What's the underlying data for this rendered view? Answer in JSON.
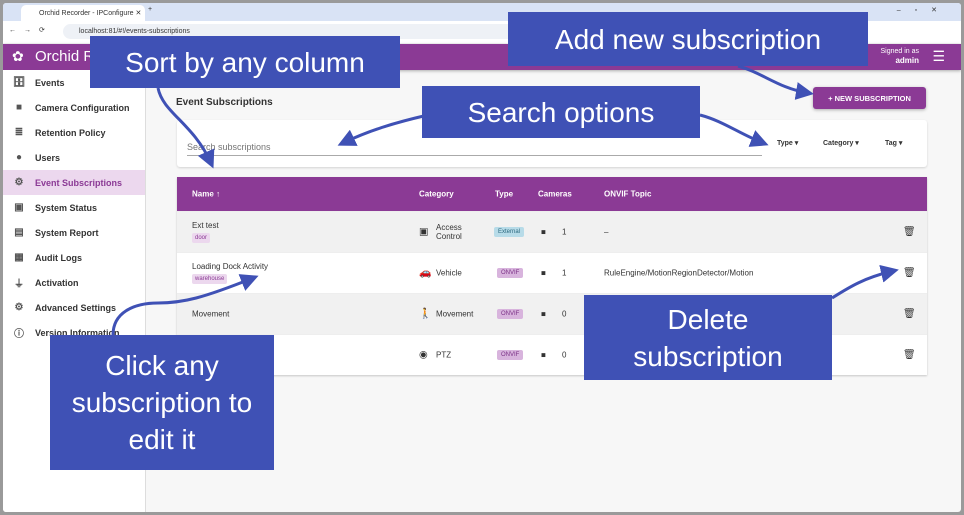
{
  "browser": {
    "tab_title": "Orchid Recorder - IPConfigure",
    "url": "localhost:81/#!/events-subscriptions"
  },
  "app": {
    "brand": "Orchid R",
    "signed_in_label": "Signed in as",
    "user": "admin"
  },
  "sidebar": {
    "items": [
      {
        "label": "Events",
        "icon": "events-search-icon"
      },
      {
        "label": "Camera Configuration",
        "icon": "video-camera-icon"
      },
      {
        "label": "Retention Policy",
        "icon": "database-icon"
      },
      {
        "label": "Users",
        "icon": "user-icon"
      },
      {
        "label": "Event Subscriptions",
        "icon": "subscriptions-gear-icon",
        "active": true
      },
      {
        "label": "System Status",
        "icon": "status-icon"
      },
      {
        "label": "System Report",
        "icon": "report-icon"
      },
      {
        "label": "Audit Logs",
        "icon": "audit-icon"
      },
      {
        "label": "Activation",
        "icon": "plug-icon"
      },
      {
        "label": "Advanced Settings",
        "icon": "gears-icon"
      },
      {
        "label": "Version Information",
        "icon": "info-icon"
      }
    ]
  },
  "main": {
    "title": "Event Subscriptions",
    "new_button": "+ NEW SUBSCRIPTION",
    "search_placeholder": "Search subscriptions",
    "filters": [
      "Type",
      "Category",
      "Tag"
    ],
    "columns": [
      "Name ↑",
      "Category",
      "Type",
      "Cameras",
      "ONVIF Topic"
    ],
    "rows": [
      {
        "name": "Ext test",
        "tag": "door",
        "category": "Access Control",
        "type": "External",
        "cameras": "1",
        "topic": "–"
      },
      {
        "name": "Loading Dock Activity",
        "tag": "warehouse",
        "category": "Vehicle",
        "type": "ONVIF",
        "cameras": "1",
        "topic": "RuleEngine/MotionRegionDetector/Motion"
      },
      {
        "name": "Movement",
        "tag": "",
        "category": "Movement",
        "type": "ONVIF",
        "cameras": "0",
        "topic": ""
      },
      {
        "name": "",
        "tag": "",
        "category": "PTZ",
        "type": "ONVIF",
        "cameras": "0",
        "topic": ""
      }
    ]
  },
  "callouts": {
    "sort": "Sort by any column",
    "add": "Add new subscription",
    "search": "Search options",
    "edit": "Click any subscription to edit it",
    "delete": "Delete subscription"
  },
  "colors": {
    "brand": "#8b3a95",
    "callout": "#3f51b5"
  }
}
